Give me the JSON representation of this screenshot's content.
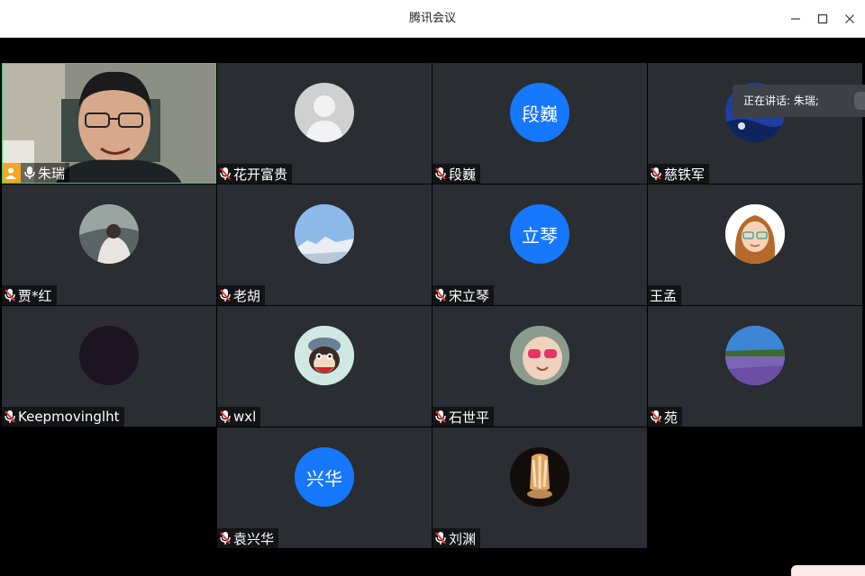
{
  "window": {
    "title": "腾讯会议"
  },
  "speaking": {
    "label": "正在讲话: 朱瑞;"
  },
  "participants": [
    {
      "name": "朱瑞",
      "avatar": "camera-video",
      "muted": false,
      "is_host": true
    },
    {
      "name": "花开富贵",
      "avatar": "default-person",
      "muted": true
    },
    {
      "name": "段巍",
      "avatar_text": "段巍",
      "avatar": "initials",
      "muted": true
    },
    {
      "name": "慈铁军",
      "avatar": "ocean-photo",
      "muted": true
    },
    {
      "name": "贾*红",
      "avatar": "photo-person",
      "muted": true
    },
    {
      "name": "老胡",
      "avatar": "snow-mountain-photo",
      "muted": true
    },
    {
      "name": "宋立琴",
      "avatar_text": "立琴",
      "avatar": "initials",
      "muted": true
    },
    {
      "name": "王孟",
      "avatar": "cartoon-girl",
      "muted": false
    },
    {
      "name": "Keepmovinglht",
      "avatar": "dark-photo",
      "muted": true
    },
    {
      "name": "wxl",
      "avatar": "monkey-cartoon",
      "muted": true
    },
    {
      "name": "石世平",
      "avatar": "baby-sunglasses",
      "muted": true
    },
    {
      "name": "苑",
      "avatar": "lavender-field-photo",
      "muted": true
    },
    {
      "name": "袁兴华",
      "avatar_text": "兴华",
      "avatar": "initials",
      "muted": true
    },
    {
      "name": "刘渊",
      "avatar": "jade-cabbage-photo",
      "muted": true
    }
  ],
  "colors": {
    "tile_bg": "#2a2d31",
    "accent_blue": "#1677ff",
    "active_speaker_border": "#3ccf67",
    "host_badge": "#f5a623",
    "muted_red": "#e53935"
  }
}
